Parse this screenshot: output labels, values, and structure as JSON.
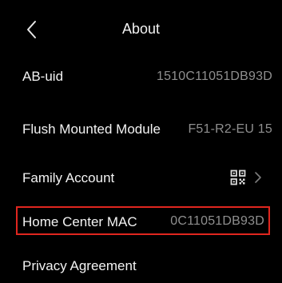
{
  "header": {
    "title": "About",
    "back_icon": "chevron-left-icon"
  },
  "rows": [
    {
      "label": "AB-uid",
      "value": "1510C11051DB93D"
    },
    {
      "label": "Flush Mounted Module",
      "value": "F51-R2-EU 15"
    },
    {
      "label": "Family Account",
      "icons": [
        "qr-code-icon",
        "chevron-right-icon"
      ]
    },
    {
      "label": "Home Center MAC",
      "value": "0C11051DB93D",
      "highlight_color": "#e0261f"
    },
    {
      "label": "Privacy Agreement"
    }
  ],
  "colors": {
    "background": "#000000",
    "text": "#f3f3f3",
    "secondary_text": "#8f8f8f",
    "highlight": "#e0261f"
  }
}
